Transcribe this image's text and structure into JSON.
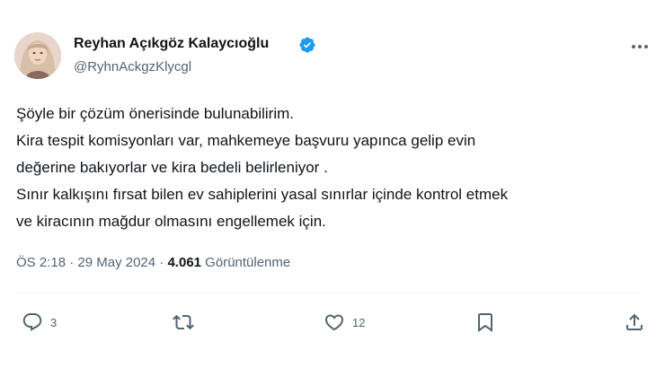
{
  "author": {
    "display_name": "Reyhan Açıkgöz Kalaycıoğlu",
    "handle": "@RyhnAckgzKlycgl",
    "verified_icon": "verified-badge-icon",
    "badge_color": "#1d9bf0"
  },
  "tweet": {
    "lines": [
      "Şöyle bir çözüm önerisinde bulunabilirim.",
      "Kira tespit komisyonları var, mahkemeye başvuru yapınca gelip evin",
      "değerine bakıyorlar ve kira bedeli belirleniyor .",
      "Sınır kalkışını fırsat bilen ev sahiplerini yasal sınırlar içinde kontrol etmek",
      "ve kiracının mağdur olmasını engellemek için."
    ]
  },
  "meta": {
    "time": "ÖS 2:18",
    "separator1": " · ",
    "date": "29 May 2024",
    "separator2": " · ",
    "views_count": "4.061",
    "views_label": " Görüntülenme"
  },
  "actions": {
    "reply_count": "3",
    "retweet_count": "",
    "like_count": "12"
  },
  "colors": {
    "text": "#0f1419",
    "secondary": "#536471",
    "divider": "#eff3f4"
  }
}
